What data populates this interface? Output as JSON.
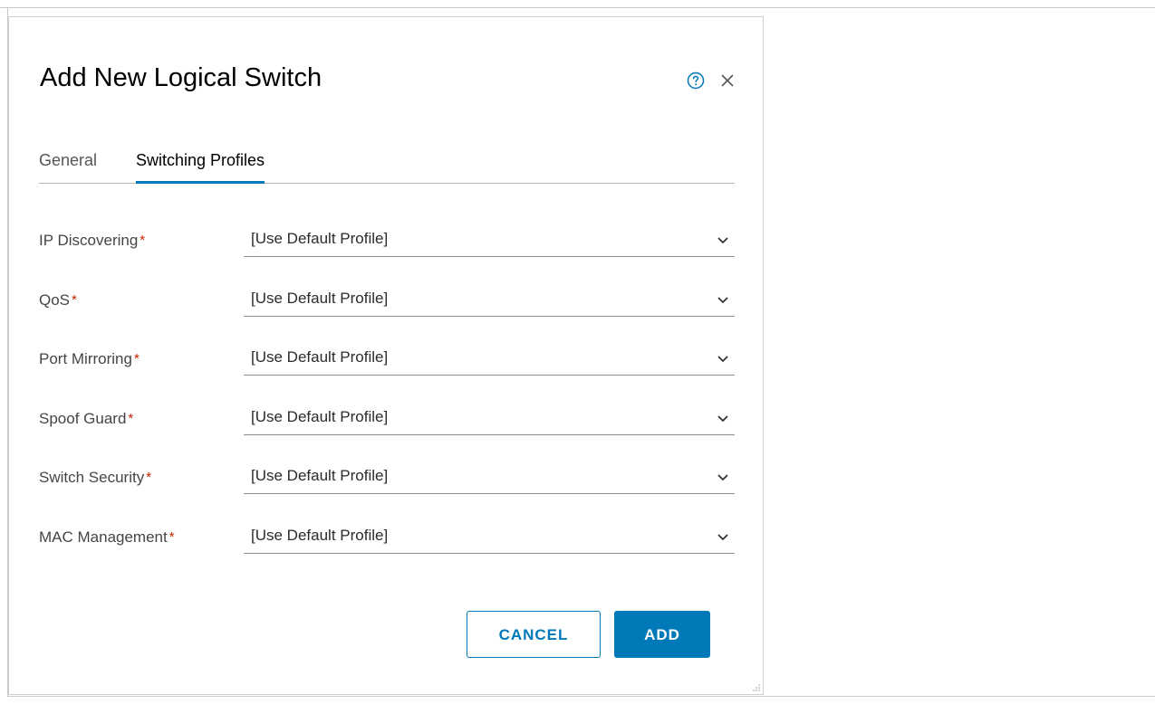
{
  "dialog": {
    "title": "Add New Logical Switch",
    "help_icon": "help-circle-icon",
    "close_icon": "close-icon"
  },
  "tabs": [
    {
      "label": "General",
      "active": false
    },
    {
      "label": "Switching Profiles",
      "active": true
    }
  ],
  "fields": [
    {
      "label": "IP Discovering",
      "required": true,
      "value": "[Use Default Profile]"
    },
    {
      "label": "QoS",
      "required": true,
      "value": "[Use Default Profile]"
    },
    {
      "label": "Port Mirroring",
      "required": true,
      "value": "[Use Default Profile]"
    },
    {
      "label": "Spoof Guard",
      "required": true,
      "value": "[Use Default Profile]"
    },
    {
      "label": "Switch Security",
      "required": true,
      "value": "[Use Default Profile]"
    },
    {
      "label": "MAC Management",
      "required": true,
      "value": "[Use Default Profile]"
    }
  ],
  "required_marker": "*",
  "buttons": {
    "cancel_label": "CANCEL",
    "add_label": "ADD"
  },
  "colors": {
    "accent": "#0079b8",
    "required": "#c92100"
  }
}
